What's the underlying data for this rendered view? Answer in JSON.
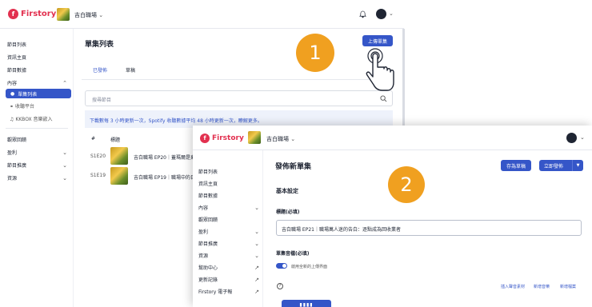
{
  "screen1": {
    "brand": "Firstory",
    "podcast_name": "吉白職場",
    "sidebar": {
      "episode_list": "節目列表",
      "info_page": "資訊主頁",
      "stats": "節目數據",
      "content": "內容",
      "episodes_active": "單集列表",
      "platforms": "收聽平台",
      "kkbox": "KKBOX 音樂嵌入",
      "audience": "觀眾回饋",
      "monetize": "盈利",
      "promotion": "節目推廣",
      "resources": "資源"
    },
    "main": {
      "title": "單集列表",
      "upload_button": "上傳單集",
      "tab_published": "已發佈",
      "tab_draft": "草稿",
      "search_placeholder": "搜尋節目",
      "info_text": "下載數每 3 小時更新一次，Spotify 收聽數據平均 48 小時更新一次，瞭解更多。",
      "col_number": "#",
      "col_title": "標題",
      "rows": [
        {
          "ep": "S1E20",
          "title": "吉白職場 EP20｜蓋瑪爾是東"
        },
        {
          "ep": "S1E19",
          "title": "吉白職場 EP19｜職場中的日"
        }
      ]
    }
  },
  "steps": {
    "one": "1",
    "two": "2"
  },
  "screen2": {
    "brand": "Firstory",
    "podcast_name": "吉白職場",
    "sidebar": {
      "episode_list": "節目列表",
      "info_page": "資訊主頁",
      "stats": "節目數據",
      "content": "內容",
      "audience": "觀眾回饋",
      "monetize": "盈利",
      "promotion": "節目推廣",
      "resources": "資源",
      "help": "幫助中心",
      "changelog": "更新記錄",
      "newsletter": "Firstory 電子報"
    },
    "main": {
      "title": "發佈新單集",
      "save_draft": "存為草稿",
      "publish_now": "立即發佈",
      "basic_settings": "基本設定",
      "title_label": "標題(必填)",
      "title_value": "吉白職場 EP21｜職場萬人迷的告白：逐點成為回收業者",
      "audio_label": "單集音檔(必填)",
      "toggle_label": "啟用全新的上傳界面",
      "insert_material": "插入聲音素材",
      "add_music": "新增音樂",
      "add_file": "新增檔案"
    }
  }
}
